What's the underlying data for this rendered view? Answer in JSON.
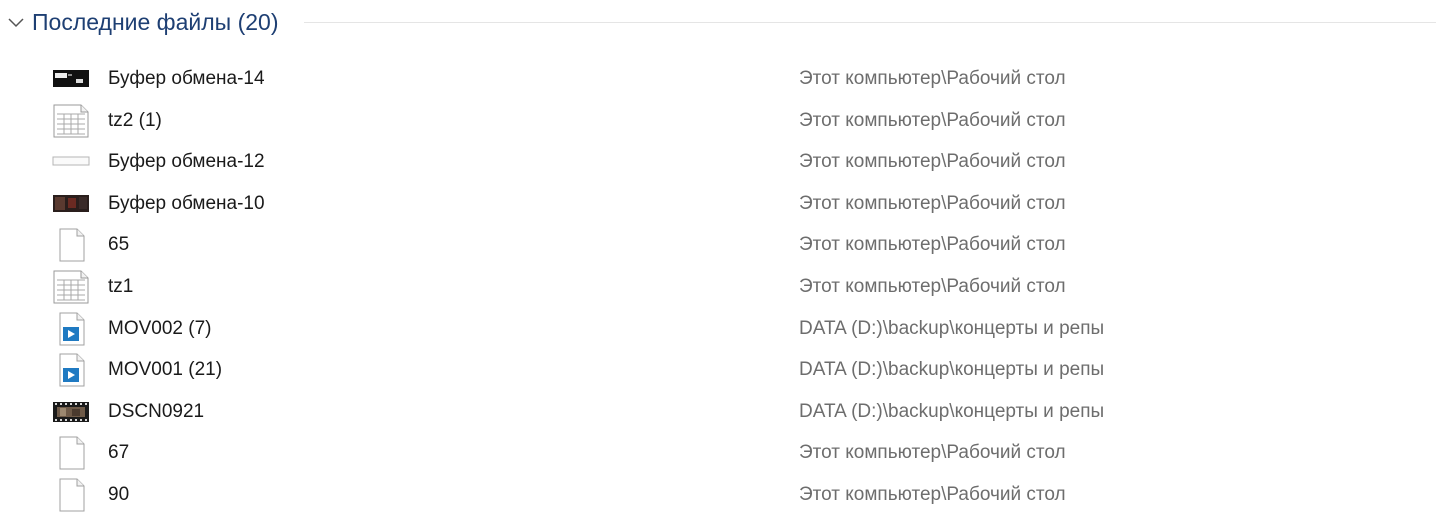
{
  "group": {
    "title": "Последние файлы (20)"
  },
  "files": [
    {
      "name": "Буфер обмена-14",
      "path": "Этот компьютер\\Рабочий стол",
      "icon": "image-thumbnail-icon"
    },
    {
      "name": "tz2 (1)",
      "path": "Этот компьютер\\Рабочий стол",
      "icon": "spreadsheet-file-icon"
    },
    {
      "name": "Буфер обмена-12",
      "path": "Этот компьютер\\Рабочий стол",
      "icon": "image-thumbnail-icon"
    },
    {
      "name": "Буфер обмена-10",
      "path": "Этот компьютер\\Рабочий стол",
      "icon": "image-thumbnail-icon"
    },
    {
      "name": "65",
      "path": "Этот компьютер\\Рабочий стол",
      "icon": "blank-file-icon"
    },
    {
      "name": "tz1",
      "path": "Этот компьютер\\Рабочий стол",
      "icon": "spreadsheet-file-icon"
    },
    {
      "name": "MOV002 (7)",
      "path": "DATA (D:)\\backup\\концерты и репы",
      "icon": "video-file-icon"
    },
    {
      "name": "MOV001 (21)",
      "path": "DATA (D:)\\backup\\концерты и репы",
      "icon": "video-file-icon"
    },
    {
      "name": "DSCN0921",
      "path": "DATA (D:)\\backup\\концерты и репы",
      "icon": "video-thumbnail-icon"
    },
    {
      "name": "67",
      "path": "Этот компьютер\\Рабочий стол",
      "icon": "blank-file-icon"
    },
    {
      "name": "90",
      "path": "Этот компьютер\\Рабочий стол",
      "icon": "blank-file-icon"
    }
  ]
}
